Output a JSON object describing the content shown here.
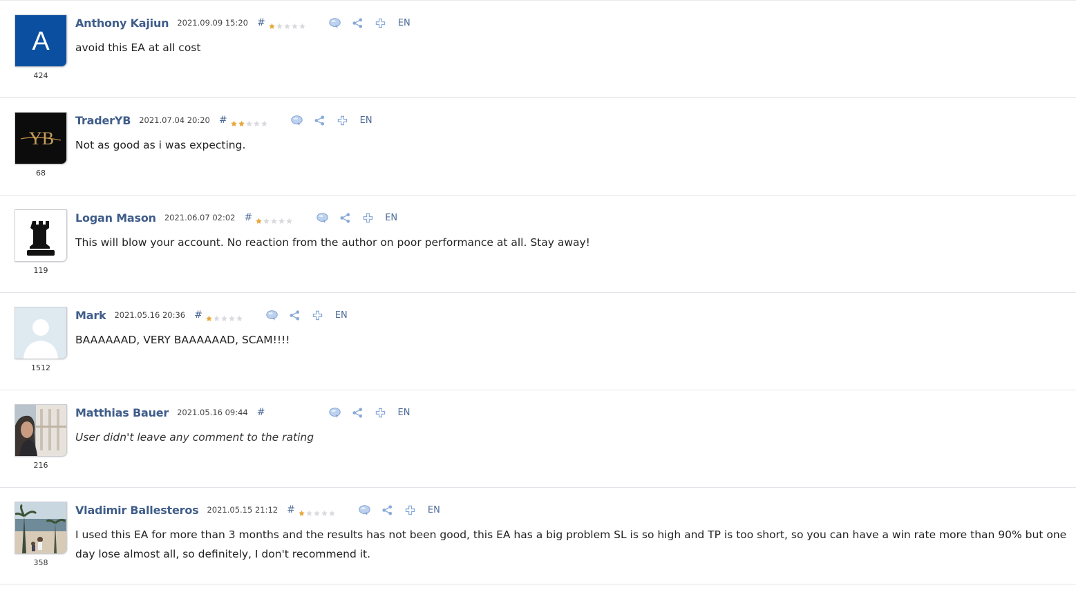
{
  "reviews": [
    {
      "author": "Anthony Kajiun",
      "date": "2021.09.09 15:20",
      "rating": 1,
      "rating_count": "424",
      "lang": "EN",
      "text": "avoid this EA at all cost",
      "no_comment": false,
      "avatar": {
        "type": "letter",
        "letter": "A",
        "bg": "#0b4fa0"
      }
    },
    {
      "author": "TraderYB",
      "date": "2021.07.04 20:20",
      "rating": 2,
      "rating_count": "68",
      "lang": "EN",
      "text": "Not as good as i was expecting.",
      "no_comment": false,
      "avatar": {
        "type": "logo",
        "logo_text": "YB",
        "bg": "#0c0c0c"
      }
    },
    {
      "author": "Logan Mason",
      "date": "2021.06.07 02:02",
      "rating": 1,
      "rating_count": "119",
      "lang": "EN",
      "text": "This will blow your account. No reaction from the author on poor performance at all. Stay away!",
      "no_comment": false,
      "avatar": {
        "type": "chess-rook"
      }
    },
    {
      "author": "Mark",
      "date": "2021.05.16 20:36",
      "rating": 1,
      "rating_count": "1512",
      "lang": "EN",
      "text": "BAAAAAAD, VERY BAAAAAAD, SCAM!!!!",
      "no_comment": false,
      "avatar": {
        "type": "default-user"
      }
    },
    {
      "author": "Matthias Bauer",
      "date": "2021.05.16 09:44",
      "rating": 0,
      "rating_count": "216",
      "lang": "EN",
      "text": "User didn't leave any comment to the rating",
      "no_comment": true,
      "avatar": {
        "type": "photo-man"
      }
    },
    {
      "author": "Vladimir Ballesteros",
      "date": "2021.05.15 21:12",
      "rating": 1,
      "rating_count": "358",
      "lang": "EN",
      "text": "I used this EA for more than 3 months and the results has not been good, this EA has a big problem SL is so high and TP is too short, so you can have a win rate more than 90% but one day lose almost all, so definitely, I don't recommend it.",
      "no_comment": false,
      "avatar": {
        "type": "photo-beach"
      }
    }
  ],
  "icons": {
    "hash": "#",
    "reply": "speech-bubble-icon",
    "share": "share-icon",
    "add": "plus-icon"
  },
  "colors": {
    "link": "#3f5d8a",
    "star_on": "#e8a63a",
    "star_off": "#d9dadd",
    "icon": "#8aaad8"
  },
  "stars_max": 5
}
